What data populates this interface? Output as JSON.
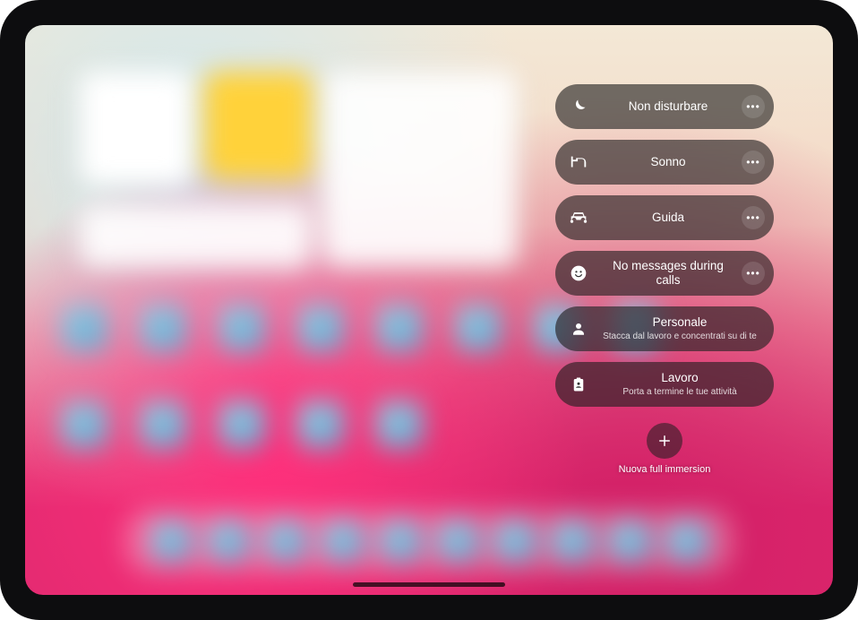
{
  "focus": {
    "items": [
      {
        "icon": "moon",
        "title": "Non disturbare",
        "subtitle": "",
        "has_more": true
      },
      {
        "icon": "bed",
        "title": "Sonno",
        "subtitle": "",
        "has_more": true
      },
      {
        "icon": "car",
        "title": "Guida",
        "subtitle": "",
        "has_more": true
      },
      {
        "icon": "smile",
        "title": "No messages during calls",
        "subtitle": "",
        "has_more": true
      },
      {
        "icon": "person",
        "title": "Personale",
        "subtitle": "Stacca dal lavoro e concentrati su di te",
        "has_more": false
      },
      {
        "icon": "badge",
        "title": "Lavoro",
        "subtitle": "Porta a termine le tue attività",
        "has_more": false
      }
    ],
    "new_label": "Nuova full immersion"
  }
}
